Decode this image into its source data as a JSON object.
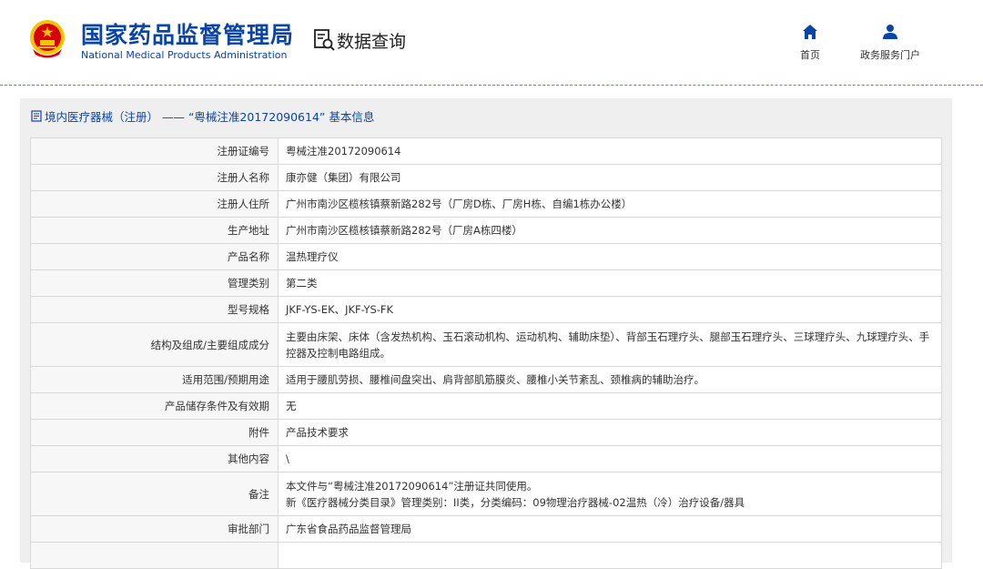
{
  "header": {
    "org_name_cn": "国家药品监督管理局",
    "org_name_en": "National Medical Products Administration",
    "data_query_label": "数据查询",
    "nav": {
      "home_label": "首页",
      "portal_label": "政务服务门户"
    }
  },
  "breadcrumb": {
    "text": "境内医疗器械（注册） —— “粤械注准20172090614” 基本信息"
  },
  "rows": [
    {
      "label": "注册证编号",
      "value": "粤械注准20172090614"
    },
    {
      "label": "注册人名称",
      "value": "康亦健（集团）有限公司"
    },
    {
      "label": "注册人住所",
      "value": "广州市南沙区榄核镇蔡新路282号（厂房D栋、厂房H栋、自编1栋办公楼）"
    },
    {
      "label": "生产地址",
      "value": "广州市南沙区榄核镇蔡新路282号（厂房A栋四楼）"
    },
    {
      "label": "产品名称",
      "value": "温热理疗仪"
    },
    {
      "label": "管理类别",
      "value": "第二类"
    },
    {
      "label": "型号规格",
      "value": "JKF-YS-EK、JKF-YS-FK"
    },
    {
      "label": "结构及组成/主要组成成分",
      "value": "主要由床架、床体（含发热机构、玉石滚动机构、运动机构、辅助床垫）、背部玉石理疗头、腿部玉石理疗头、三球理疗头、九球理疗头、手控器及控制电路组成。"
    },
    {
      "label": "适用范围/预期用途",
      "value": "适用于腰肌劳损、腰椎间盘突出、肩背部肌筋膜炎、腰椎小关节紊乱、颈椎病的辅助治疗。"
    },
    {
      "label": "产品储存条件及有效期",
      "value": "无"
    },
    {
      "label": "附件",
      "value": "产品技术要求"
    },
    {
      "label": "其他内容",
      "value": "\\"
    },
    {
      "label": "备注",
      "value_line1": "本文件与“粤械注准20172090614”注册证共同使用。",
      "value_line2": "新《医疗器械分类目录》管理类别：II类，分类编码：09物理治疗器械-02温热（冷）治疗设备/器具"
    },
    {
      "label": "审批部门",
      "value": "广东省食品药品监督管理局"
    },
    {
      "label": "",
      "value": ""
    }
  ],
  "colors": {
    "brand_blue": "#0a44a6",
    "emblem_red": "#d7000f",
    "emblem_gold": "#f5c400"
  }
}
